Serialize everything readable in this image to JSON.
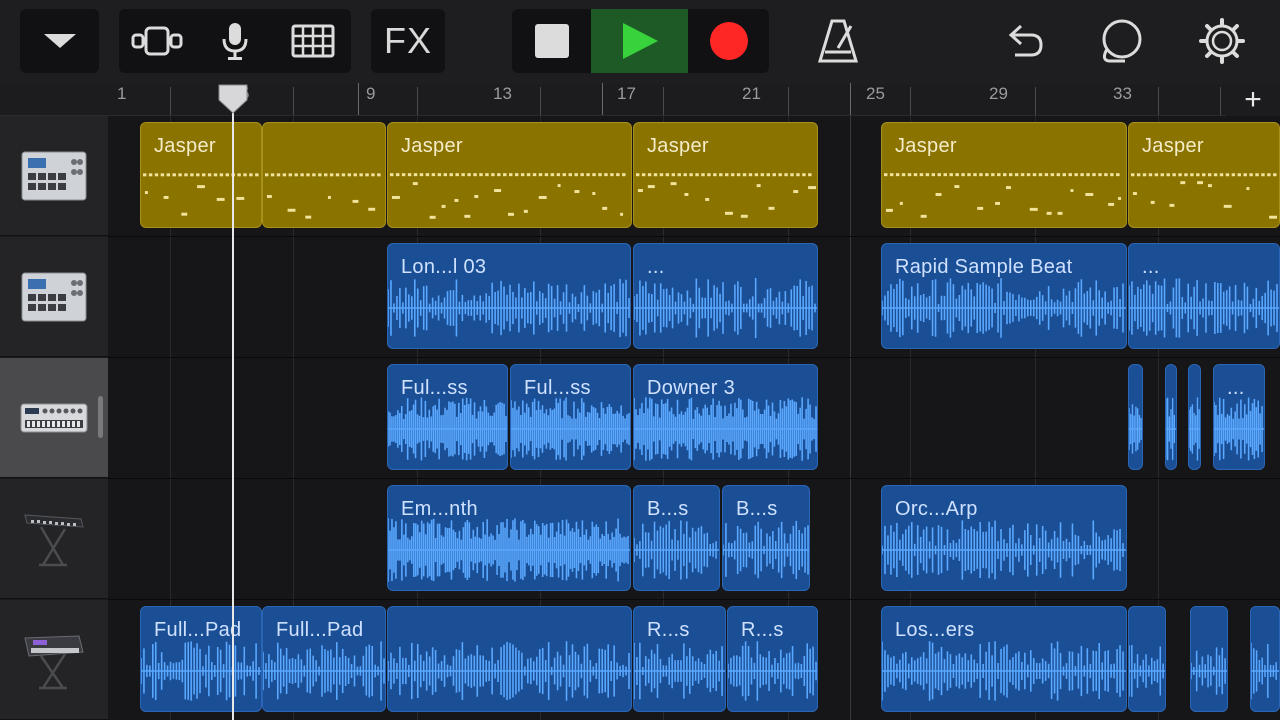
{
  "toolbar": {
    "menu_icon": "chevron-down-icon",
    "view_icon": "tracks-view-icon",
    "mic_icon": "microphone-icon",
    "grid_icon": "grid-icon",
    "fx_label": "FX",
    "stop_icon": "stop-icon",
    "play_icon": "play-icon",
    "record_icon": "record-icon",
    "metronome_icon": "metronome-icon",
    "undo_icon": "undo-icon",
    "loop_icon": "loop-icon",
    "settings_icon": "gear-icon"
  },
  "colors": {
    "play_active": "#1e7a2c",
    "play_glyph": "#36d13a",
    "record": "#ff2b2b",
    "region_gold": "#8b7300",
    "region_blue": "#1a4f96",
    "wave_blue": "#5aa8ff"
  },
  "ruler": {
    "bar_numbers": [
      "1",
      "5",
      "9",
      "13",
      "17",
      "21",
      "25",
      "29",
      "33"
    ],
    "add_label": "+"
  },
  "tracks": [
    {
      "instrument": "drum-machine-icon",
      "regions": [
        {
          "label": "Jasper",
          "type": "midi"
        },
        {
          "label": "",
          "type": "midi"
        },
        {
          "label": "Jasper",
          "type": "midi"
        },
        {
          "label": "Jasper",
          "type": "midi"
        },
        {
          "label": "Jasper",
          "type": "midi"
        },
        {
          "label": "Jasper",
          "type": "midi"
        }
      ]
    },
    {
      "instrument": "drum-machine-icon",
      "regions": [
        {
          "label": "Lon...l 03",
          "type": "audio"
        },
        {
          "label": "...",
          "type": "audio"
        },
        {
          "label": "Rapid Sample Beat",
          "type": "audio"
        },
        {
          "label": "...",
          "type": "audio"
        }
      ]
    },
    {
      "instrument": "synth-module-icon",
      "regions": [
        {
          "label": "Ful...ss",
          "type": "audio"
        },
        {
          "label": "Ful...ss",
          "type": "audio"
        },
        {
          "label": "Downer 3",
          "type": "audio"
        },
        {
          "label": "...",
          "type": "audio"
        }
      ]
    },
    {
      "instrument": "keyboard-stand-icon",
      "regions": [
        {
          "label": "Em...nth",
          "type": "audio"
        },
        {
          "label": "B...s",
          "type": "audio"
        },
        {
          "label": "B...s",
          "type": "audio"
        },
        {
          "label": "Orc...Arp",
          "type": "audio"
        }
      ]
    },
    {
      "instrument": "synth-keyboard-icon",
      "regions": [
        {
          "label": "Full...Pad",
          "type": "audio"
        },
        {
          "label": "Full...Pad",
          "type": "audio"
        },
        {
          "label": "R...s",
          "type": "audio"
        },
        {
          "label": "R...s",
          "type": "audio"
        },
        {
          "label": "Los...ers",
          "type": "audio"
        }
      ]
    }
  ]
}
